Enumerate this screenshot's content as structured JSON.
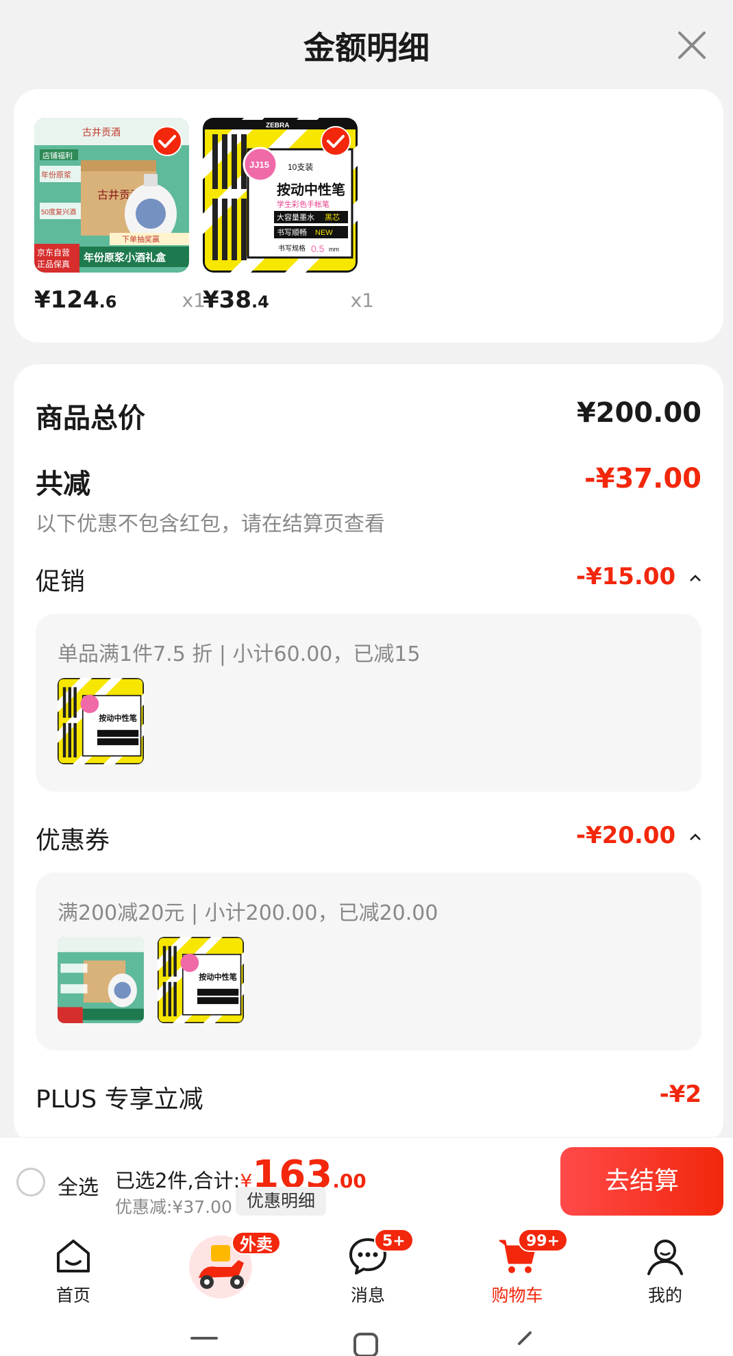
{
  "sheet": {
    "title": "金额明细"
  },
  "products": [
    {
      "price_int": "¥124",
      "price_dec": ".6",
      "qty": "x1",
      "name": "古井贡酒"
    },
    {
      "price_int": "¥38",
      "price_dec": ".4",
      "qty": "x1",
      "name": "ZEBRA 按动中性笔"
    }
  ],
  "thumb_texts": {
    "wine_brand": "古井贡酒",
    "wine_promo1": "店铺福利",
    "wine_promo2": "年份原浆",
    "wine_promo3": "50度复兴酒",
    "wine_bottom": "年份原浆小酒礼盒",
    "wine_gift": "下单抽奖赢",
    "wine_badge1": "京东自营",
    "wine_badge2": "正品保真",
    "pen_brand": "ZEBRA",
    "pen_model": "JJ15",
    "pen_count": "10支装",
    "pen_title": "按动中性笔",
    "pen_sub1": "学生彩色手帐笔",
    "pen_sub2": "大容量墨水",
    "pen_sub2b": "黑芯",
    "pen_sub3": "书写顺畅",
    "pen_sub3b": "NEW",
    "pen_sub4": "书写规格",
    "pen_size": "0.5",
    "pen_unit": "mm"
  },
  "summary": {
    "total_label": "商品总价",
    "total_value": "¥200.00",
    "reduce_label": "共减",
    "reduce_value": "-¥37.00",
    "note": "以下优惠不包含红包，请在结算页查看"
  },
  "promotion": {
    "label": "促销",
    "value": "-¥15.00",
    "detail": "单品满1件7.5 折 | 小计60.00，已减15"
  },
  "coupon": {
    "label": "优惠券",
    "value": "-¥20.00",
    "detail": "满200减20元 | 小计200.00，已减20.00"
  },
  "plus": {
    "label": "PLUS 专享立减",
    "value": "-¥2"
  },
  "checkout": {
    "select_all": "全选",
    "selected_text": "已选2件,合计:",
    "yen": "¥",
    "total_int": "163",
    "total_dec": ".00",
    "discount_text": "优惠减:¥37.00",
    "detail_btn": "优惠明细",
    "checkout_btn": "去结算"
  },
  "tabs": [
    {
      "label": "首页",
      "icon": "home-icon"
    },
    {
      "label": "",
      "icon": "delivery-scooter-icon",
      "badge": "外卖"
    },
    {
      "label": "消息",
      "icon": "message-icon",
      "badge": "5+"
    },
    {
      "label": "购物车",
      "icon": "cart-icon",
      "badge": "99+",
      "active": true
    },
    {
      "label": "我的",
      "icon": "profile-icon"
    }
  ],
  "colors": {
    "accent": "#f2270c",
    "background": "#f2f2f2",
    "card": "#ffffff",
    "muted": "#888888"
  }
}
